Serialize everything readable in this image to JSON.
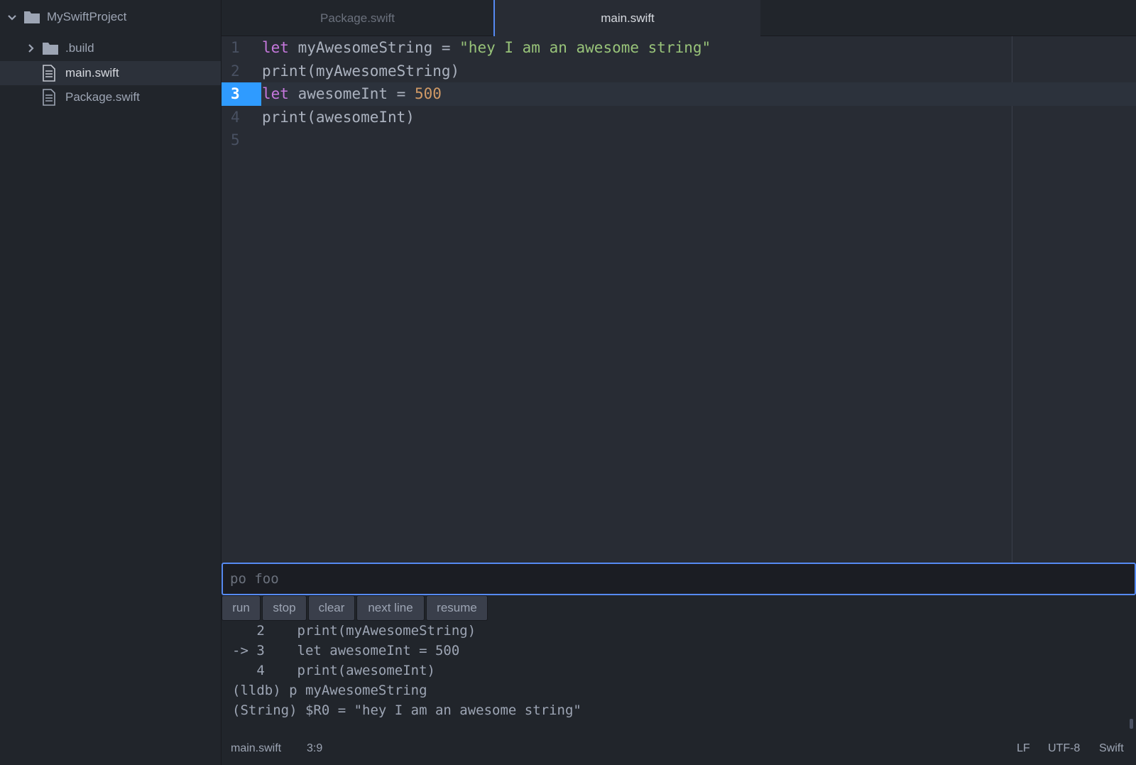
{
  "sidebar": {
    "project": "MySwiftProject",
    "items": [
      {
        "label": ".build",
        "type": "folder"
      },
      {
        "label": "main.swift",
        "type": "file",
        "selected": true
      },
      {
        "label": "Package.swift",
        "type": "file"
      }
    ]
  },
  "tabs": [
    {
      "label": "Package.swift",
      "active": false
    },
    {
      "label": "main.swift",
      "active": true
    }
  ],
  "editor": {
    "line_numbers": [
      "1",
      "2",
      "3",
      "4",
      "5"
    ],
    "active_line": "3",
    "lines": [
      {
        "tokens": [
          {
            "t": "let",
            "c": "kw"
          },
          {
            "t": " myAwesomeString = ",
            "c": "plain"
          },
          {
            "t": "\"hey I am an awesome string\"",
            "c": "str"
          }
        ]
      },
      {
        "tokens": [
          {
            "t": "print(myAwesomeString)",
            "c": "plain"
          }
        ]
      },
      {
        "tokens": [
          {
            "t": "let",
            "c": "kw"
          },
          {
            "t": " awesomeInt = ",
            "c": "plain"
          },
          {
            "t": "500",
            "c": "num"
          }
        ]
      },
      {
        "tokens": [
          {
            "t": "print(awesomeInt)",
            "c": "plain"
          }
        ]
      },
      {
        "tokens": []
      }
    ]
  },
  "debugger": {
    "input_placeholder": "po foo",
    "input_value": "",
    "buttons": [
      "run",
      "stop",
      "clear",
      "next line",
      "resume"
    ],
    "console": [
      "   2    print(myAwesomeString)",
      "-> 3    let awesomeInt = 500",
      "   4    print(awesomeInt)",
      "(lldb) p myAwesomeString",
      "(String) $R0 = \"hey I am an awesome string\""
    ]
  },
  "status": {
    "file": "main.swift",
    "cursor": "3:9",
    "line_ending": "LF",
    "encoding": "UTF-8",
    "grammar": "Swift"
  },
  "colors": {
    "accent": "#568af2",
    "active_line_number": "#2f9bff",
    "keyword": "#c678dd",
    "string": "#98c379",
    "number": "#d19a66"
  }
}
